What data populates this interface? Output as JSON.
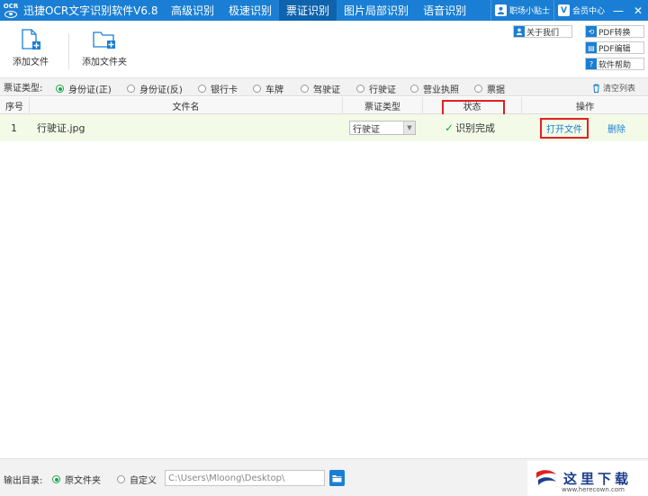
{
  "app": {
    "logo_text": "OCR",
    "title": "迅捷OCR文字识别软件V6.8",
    "tabs": [
      "高级识别",
      "极速识别",
      "票证识别",
      "图片局部识别",
      "语音识别"
    ],
    "active_tab": "票证识别",
    "assistant": "职场小贴士",
    "member": "会员中心",
    "member_icon": "V"
  },
  "toolbar": {
    "add_file": "添加文件",
    "add_folder": "添加文件夹",
    "about": "关于我们",
    "pdf_convert": "PDF转换",
    "pdf_edit": "PDF编辑",
    "help": "软件帮助"
  },
  "type_filter": {
    "label": "票证类型:",
    "options": [
      "身份证(正)",
      "身份证(反)",
      "银行卡",
      "车牌",
      "驾驶证",
      "行驶证",
      "营业执照",
      "票据"
    ],
    "selected": "身份证(正)",
    "clear": "清空列表"
  },
  "table": {
    "headers": [
      "序号",
      "文件名",
      "票证类型",
      "状态",
      "操作"
    ],
    "rows": [
      {
        "index": "1",
        "filename": "行驶证.jpg",
        "type": "行驶证",
        "status": "识别完成",
        "open": "打开文件",
        "delete": "删除"
      }
    ]
  },
  "footer": {
    "output_label": "输出目录:",
    "opt_source": "原文件夹",
    "opt_custom": "自定义",
    "path": "C:\\Users\\Mloong\\Desktop\\",
    "selected": "原文件夹"
  },
  "watermark": {
    "text": "这里下载",
    "url": "www.herecown.com"
  },
  "colors": {
    "accent": "#1a7fd4",
    "active_tab": "#0f63ad",
    "success": "#1aa34a",
    "highlight_box": "#e02020",
    "row_bg": "#f3fbe8"
  }
}
